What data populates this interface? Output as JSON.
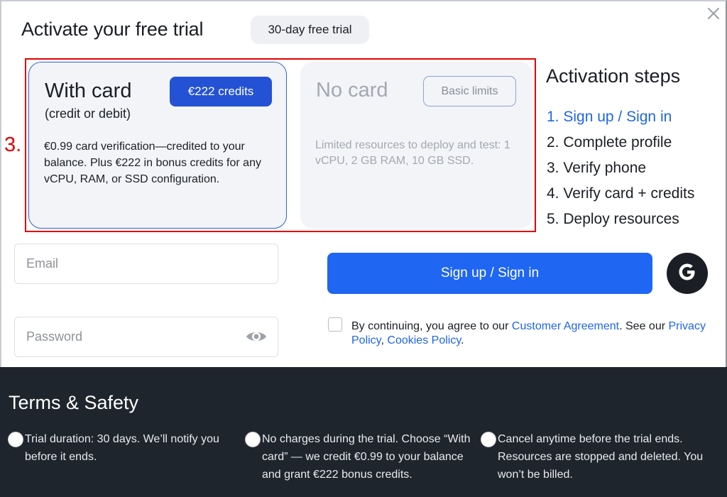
{
  "header": {
    "title": "Activate your free trial",
    "trial_badge": "30-day free trial"
  },
  "annotation": {
    "step_number": "3."
  },
  "plans": {
    "with_card": {
      "title": "With card",
      "subtitle": "(credit or debit)",
      "badge": "€222 credits",
      "description": "€0.99 card verification—credited to your balance. Plus €222 in bonus credits for any vCPU, RAM, or SSD configuration."
    },
    "no_card": {
      "title": "No card",
      "badge": "Basic limits",
      "description": "Limited resources to deploy and test: 1 vCPU, 2 GB RAM, 10 GB SSD."
    }
  },
  "activation": {
    "title": "Activation steps",
    "steps": [
      "1. Sign up / Sign in",
      "2. Complete profile",
      "3. Verify phone",
      "4. Verify card + credits",
      "5. Deploy resources"
    ]
  },
  "form": {
    "email_placeholder": "Email",
    "password_placeholder": "Password",
    "signin_label": "Sign up / Sign in",
    "consent_prefix": "By continuing, you agree to our ",
    "customer_agreement": "Customer Agreement",
    "consent_mid": ". See our ",
    "privacy_policy": "Privacy Policy",
    "comma": ", ",
    "cookies_policy": "Cookies Policy",
    "period": "."
  },
  "terms": {
    "title": "Terms & Safety",
    "items": [
      "Trial duration: 30 days. We’ll notify you before it ends.",
      "No charges during the trial. Choose “With card” — we credit €0.99 to your balance and grant €222 bonus credits.",
      "Cancel anytime before the trial ends. Resources are stopped and deleted. You won’t be billed."
    ]
  },
  "colors": {
    "accent": "#1f66f2",
    "badge_blue": "#2452d4",
    "annotation_red": "#e30000",
    "footer_bg": "#1f252d"
  }
}
